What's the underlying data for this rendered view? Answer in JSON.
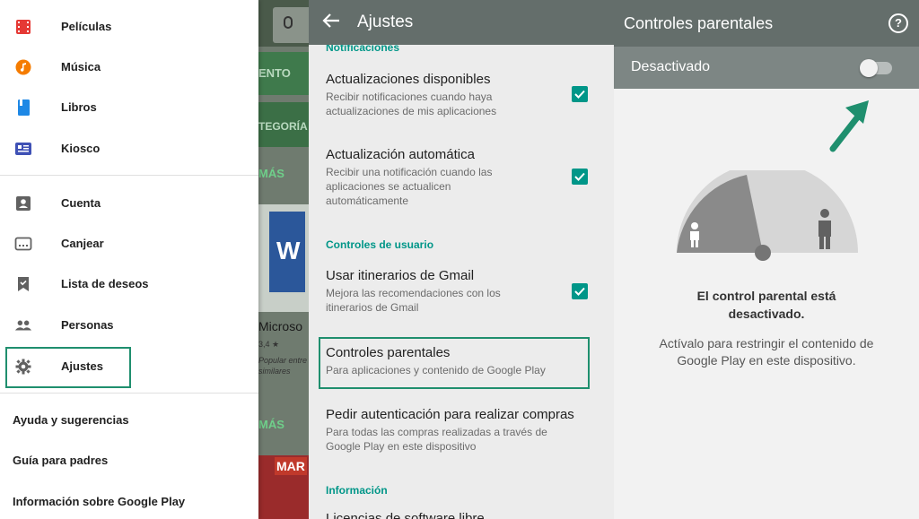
{
  "drawer": {
    "items": [
      {
        "label": "Películas",
        "icon": "movies-icon"
      },
      {
        "label": "Música",
        "icon": "music-icon"
      },
      {
        "label": "Libros",
        "icon": "books-icon"
      },
      {
        "label": "Kiosco",
        "icon": "newsstand-icon"
      },
      {
        "label": "Cuenta",
        "icon": "account-icon"
      },
      {
        "label": "Canjear",
        "icon": "redeem-icon"
      },
      {
        "label": "Lista de deseos",
        "icon": "wishlist-icon"
      },
      {
        "label": "Personas",
        "icon": "people-icon"
      },
      {
        "label": "Ajustes",
        "icon": "settings-icon"
      }
    ],
    "footer": [
      "Ayuda y sugerencias",
      "Guía para padres",
      "Información sobre Google Play"
    ]
  },
  "background": {
    "strip1": "ENTO",
    "strip2": "TEGORÍA",
    "strip3": "MÁS",
    "card_title": "Microso",
    "card_rating": "3,4 ★",
    "card_sub": "Popular entre similares",
    "strip4": "MÁS",
    "card2": "MAR"
  },
  "settings": {
    "title": "Ajustes",
    "section_notifications": "Notificaciones",
    "updates_title": "Actualizaciones disponibles",
    "updates_sub": "Recibir notificaciones cuando haya actualizaciones de mis aplicaciones",
    "auto_title": "Actualización automática",
    "auto_sub": "Recibir una notificación cuando las aplicaciones se actualicen automáticamente",
    "section_user": "Controles de usuario",
    "gmail_title": "Usar itinerarios de Gmail",
    "gmail_sub": "Mejora las recomendaciones con los itinerarios de Gmail",
    "parental_title": "Controles parentales",
    "parental_sub": "Para aplicaciones y contenido de Google Play",
    "auth_title": "Pedir autenticación para realizar compras",
    "auth_sub": "Para todas las compras realizadas a través de Google Play en este dispositivo",
    "section_info": "Información",
    "info_partial": "Licencias de software libre"
  },
  "parental": {
    "title": "Controles parentales",
    "toggle_label": "Desactivado",
    "msg_title": "El control parental está desactivado.",
    "msg_body": "Actívalo para restringir el contenido de Google Play en este dispositivo."
  },
  "colors": {
    "accent": "#009688",
    "highlight_border": "#1f8f6e",
    "header": "#646e6b"
  }
}
